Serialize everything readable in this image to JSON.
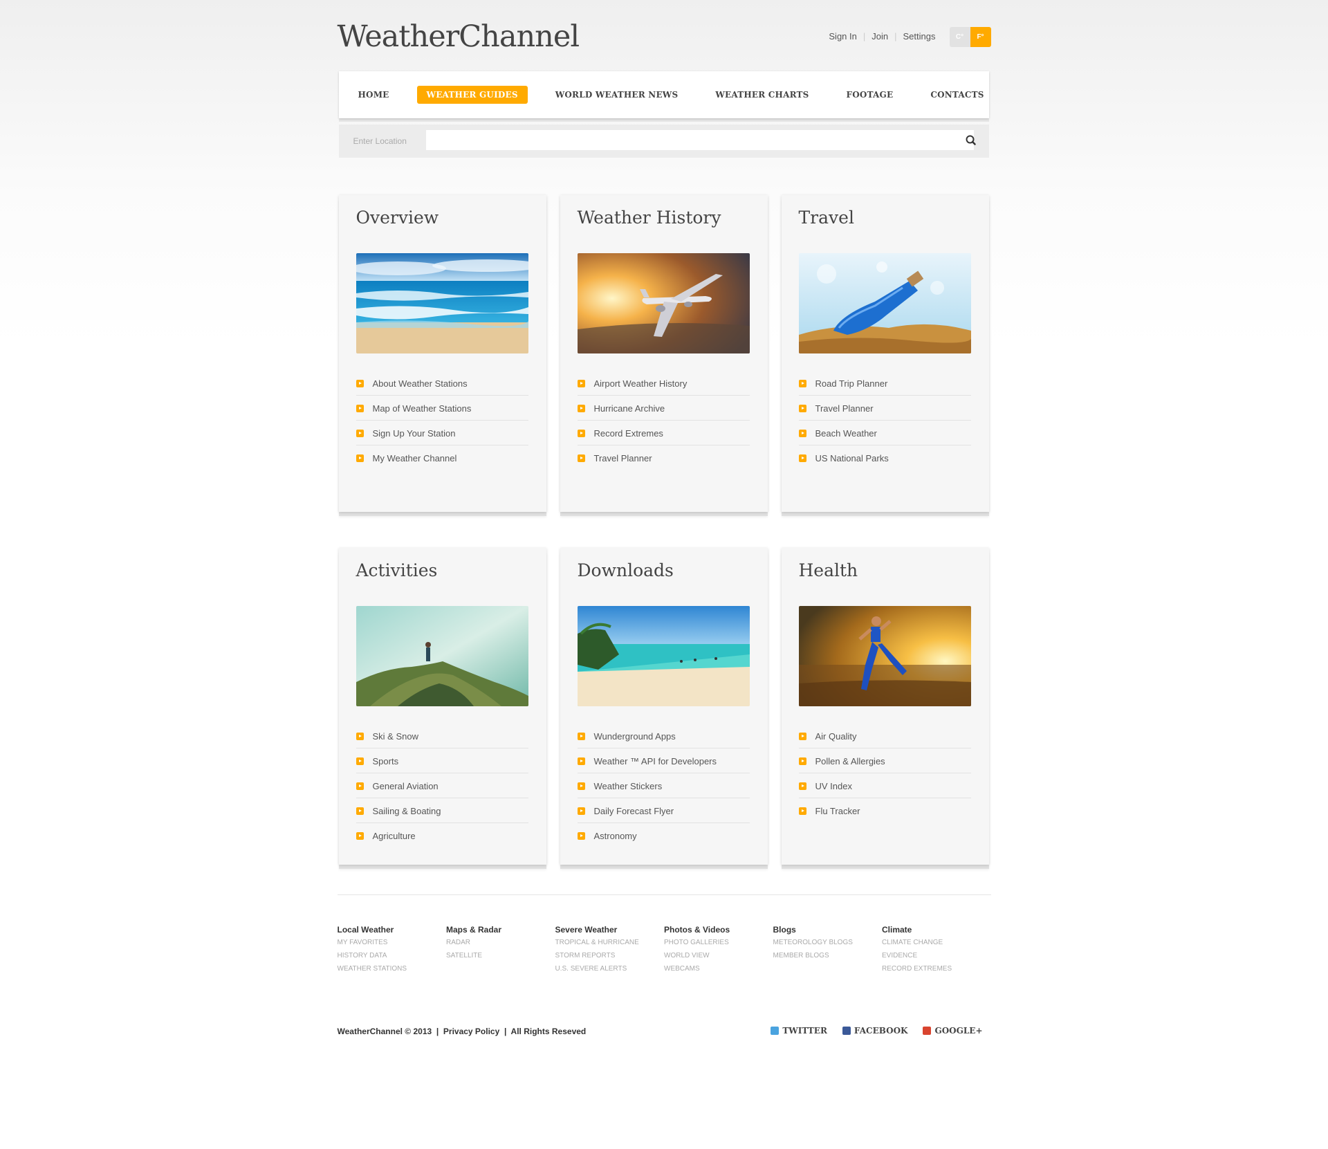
{
  "header": {
    "logo": "WeatherChannel",
    "links": [
      "Sign In",
      "Join",
      "Settings"
    ],
    "units": [
      "C°",
      "F°"
    ]
  },
  "nav": {
    "items": [
      "HOME",
      "WEATHER GUIDES",
      "WORLD WEATHER NEWS",
      "WEATHER CHARTS",
      "FOOTAGE",
      "CONTACTS"
    ],
    "active": "WEATHER GUIDES"
  },
  "search": {
    "label": "Enter Location",
    "placeholder": ""
  },
  "cards": [
    {
      "title": "Overview",
      "image": "ocean-beach",
      "items": [
        "About Weather Stations",
        "Map of Weather Stations",
        "Sign Up Your Station",
        "My Weather Channel"
      ]
    },
    {
      "title": "Weather History",
      "image": "airplane-sunset",
      "items": [
        "Airport Weather History",
        "Hurricane Archive",
        "Record Extremes",
        "Travel Planner"
      ]
    },
    {
      "title": "Travel",
      "image": "bottle-on-sand",
      "items": [
        "Road Trip Planner",
        "Travel Planner",
        "Beach Weather",
        "US National Parks"
      ]
    },
    {
      "title": "Activities",
      "image": "hiker-on-cliff",
      "items": [
        "Ski & Snow",
        "Sports",
        "General Aviation",
        "Sailing & Boating",
        "Agriculture"
      ]
    },
    {
      "title": "Downloads",
      "image": "tropical-beach",
      "items": [
        "Wunderground Apps",
        "Weather ™ API for Developers",
        "Weather Stickers",
        "Daily Forecast Flyer",
        "Astronomy"
      ]
    },
    {
      "title": "Health",
      "image": "runner-on-beach",
      "items": [
        "Air Quality",
        "Pollen & Allergies",
        "UV Index",
        "Flu Tracker"
      ]
    }
  ],
  "footer": {
    "columns": [
      {
        "heading": "Local Weather",
        "links": [
          "MY FAVORITES",
          "HISTORY DATA",
          "WEATHER STATIONS"
        ]
      },
      {
        "heading": "Maps & Radar",
        "links": [
          "RADAR",
          "SATELLITE"
        ]
      },
      {
        "heading": "Severe Weather",
        "links": [
          "TROPICAL & HURRICANE",
          "STORM REPORTS",
          "U.S. SEVERE ALERTS"
        ]
      },
      {
        "heading": "Photos & Videos",
        "links": [
          "PHOTO GALLERIES",
          "WORLD VIEW",
          "WEBCAMS"
        ]
      },
      {
        "heading": "Blogs",
        "links": [
          "METEOROLOGY BLOGS",
          "MEMBER BLOGS"
        ]
      },
      {
        "heading": "Climate",
        "links": [
          "CLIMATE CHANGE",
          "EVIDENCE",
          "RECORD EXTREMES"
        ]
      }
    ],
    "copyright": "WeatherChannel © 2013",
    "privacy": "Privacy Policy",
    "rights": "All Rights Reseved",
    "social": [
      "TWITTER",
      "FACEBOOK",
      "GOOGLE+"
    ]
  },
  "colors": {
    "accent": "#ffaa00",
    "text": "#555555",
    "heading": "#444444"
  }
}
